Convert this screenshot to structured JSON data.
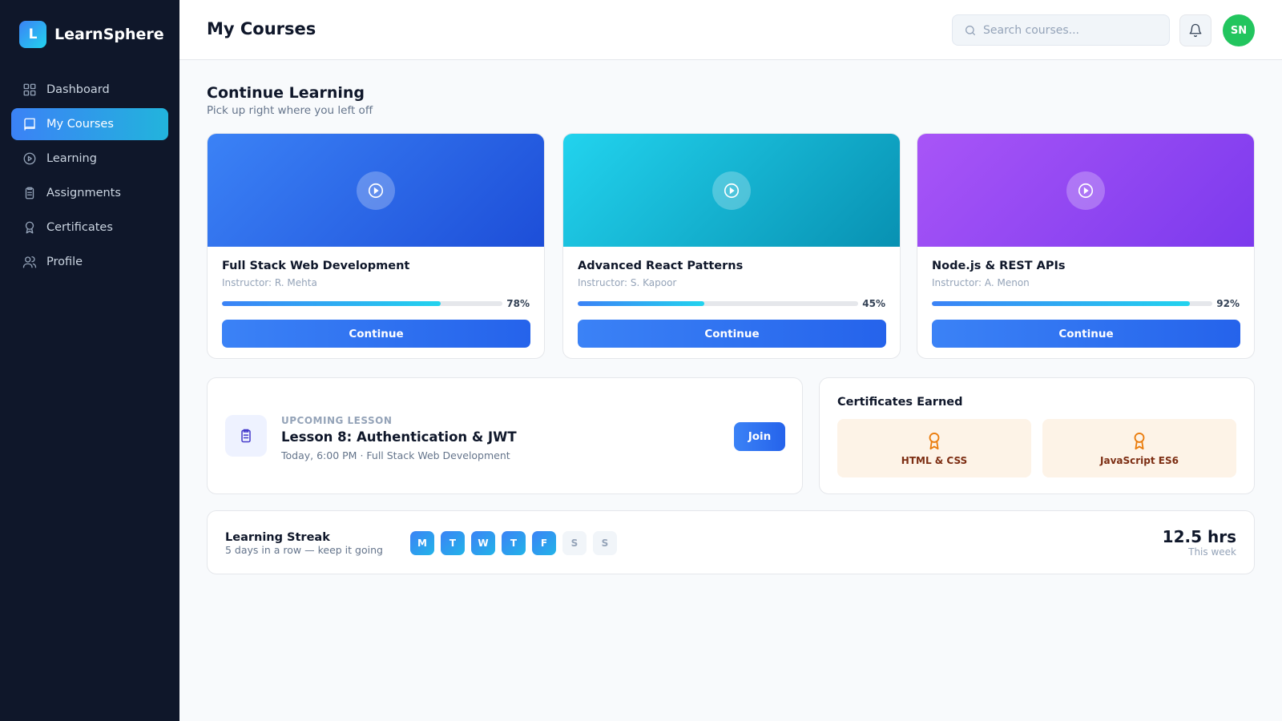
{
  "brand": {
    "logo_letter": "L",
    "name": "LearnSphere"
  },
  "sidebar": {
    "items": [
      {
        "label": "Dashboard",
        "icon": "grid-icon",
        "active": false
      },
      {
        "label": "My Courses",
        "icon": "book-icon",
        "active": true
      },
      {
        "label": "Learning",
        "icon": "play-circle-icon",
        "active": false
      },
      {
        "label": "Assignments",
        "icon": "clipboard-icon",
        "active": false
      },
      {
        "label": "Certificates",
        "icon": "award-icon",
        "active": false
      },
      {
        "label": "Profile",
        "icon": "users-icon",
        "active": false
      }
    ]
  },
  "header": {
    "title": "My Courses",
    "search_placeholder": "Search courses...",
    "avatar_initials": "SN"
  },
  "continue_learning": {
    "title": "Continue Learning",
    "subtitle": "Pick up right where you left off",
    "courses": [
      {
        "title": "Full Stack Web Development",
        "instructor": "Instructor: R. Mehta",
        "progress": 78,
        "progress_label": "78%",
        "button": "Continue",
        "gradient": [
          "#3b82f6",
          "#1d4ed8"
        ]
      },
      {
        "title": "Advanced React Patterns",
        "instructor": "Instructor: S. Kapoor",
        "progress": 45,
        "progress_label": "45%",
        "button": "Continue",
        "gradient": [
          "#22d3ee",
          "#0891b2"
        ]
      },
      {
        "title": "Node.js & REST APIs",
        "instructor": "Instructor: A. Menon",
        "progress": 92,
        "progress_label": "92%",
        "button": "Continue",
        "gradient": [
          "#a855f7",
          "#7c3aed"
        ]
      }
    ]
  },
  "upcoming": {
    "label": "UPCOMING LESSON",
    "title": "Lesson 8: Authentication & JWT",
    "meta": "Today, 6:00 PM · Full Stack Web Development",
    "button": "Join"
  },
  "certificates": {
    "title": "Certificates Earned",
    "items": [
      {
        "name": "HTML & CSS"
      },
      {
        "name": "JavaScript ES6"
      }
    ]
  },
  "streak": {
    "title": "Learning Streak",
    "subtitle": "5 days in a row — keep it going",
    "days": [
      {
        "letter": "M",
        "done": true
      },
      {
        "letter": "T",
        "done": true
      },
      {
        "letter": "W",
        "done": true
      },
      {
        "letter": "T",
        "done": true
      },
      {
        "letter": "F",
        "done": true
      },
      {
        "letter": "S",
        "done": false
      },
      {
        "letter": "S",
        "done": false
      }
    ],
    "hours": "12.5 hrs",
    "hours_label": "This week"
  },
  "colors": {
    "sidebar_bg": "#0f172a",
    "accent": "#3b82f6",
    "avatar": "#22c55e",
    "cert_bg": "#fdf3e7"
  }
}
